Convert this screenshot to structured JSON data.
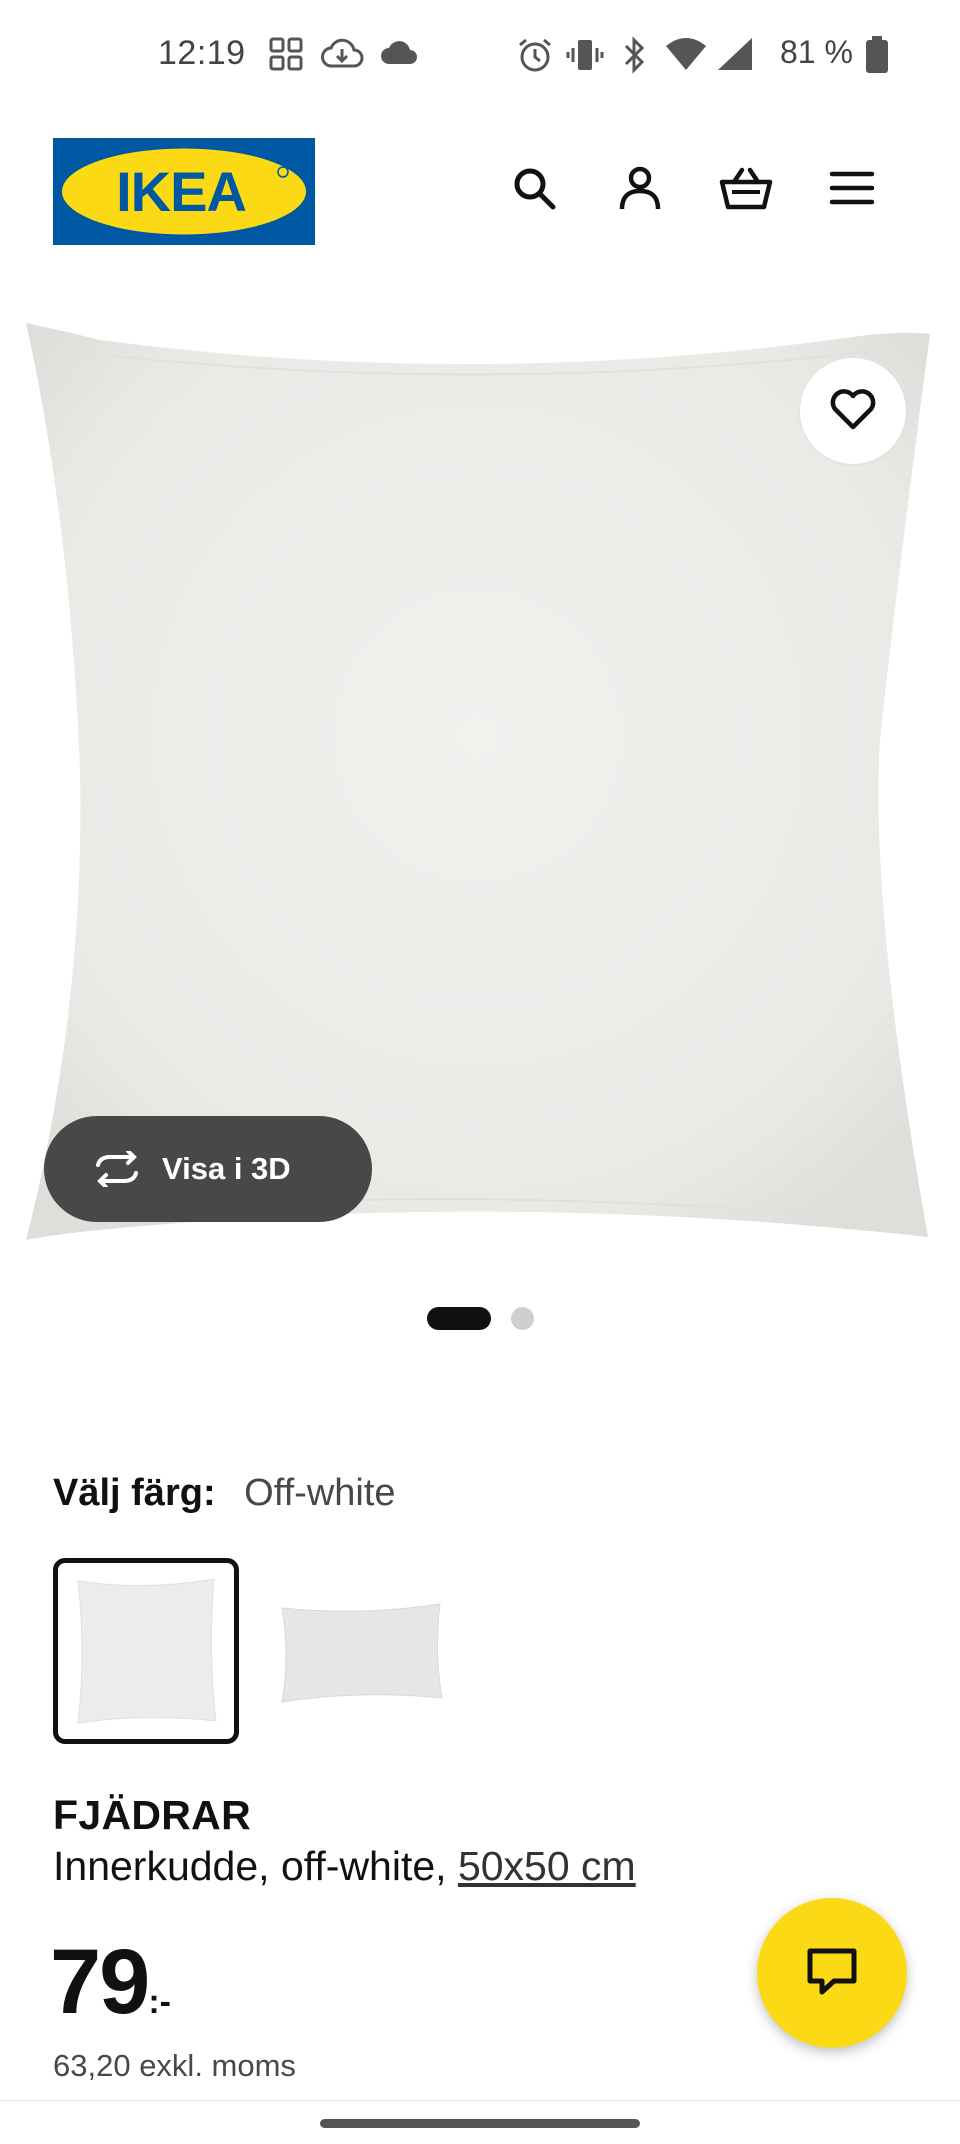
{
  "status_bar": {
    "time": "12:19",
    "battery_percent": "81 %",
    "icons": [
      "gallery-icon",
      "cloud-download-icon",
      "cloud-icon",
      "alarm-icon",
      "vibrate-icon",
      "bluetooth-icon",
      "wifi-icon",
      "signal-icon",
      "battery-icon"
    ]
  },
  "header": {
    "logo_text": "IKEA",
    "logo_colors": {
      "blue": "#0058A3",
      "yellow": "#FBD914"
    },
    "icons": [
      "search-icon",
      "account-icon",
      "cart-icon",
      "menu-icon"
    ]
  },
  "gallery": {
    "view_3d_label": "Visa i 3D",
    "active_slide": 1,
    "slide_count": 2
  },
  "color_selector": {
    "label": "Välj färg:",
    "value": "Off-white",
    "selected_index": 0
  },
  "product": {
    "name": "FJÄDRAR",
    "description": "Innerkudde, off-white, ",
    "size": "50x50 cm",
    "price_integer": "79",
    "price_suffix": ":-",
    "price_excl_vat": "63,20 exkl. moms"
  },
  "colors": {
    "accent_yellow": "#FBD914",
    "dark_button": "#484848"
  }
}
